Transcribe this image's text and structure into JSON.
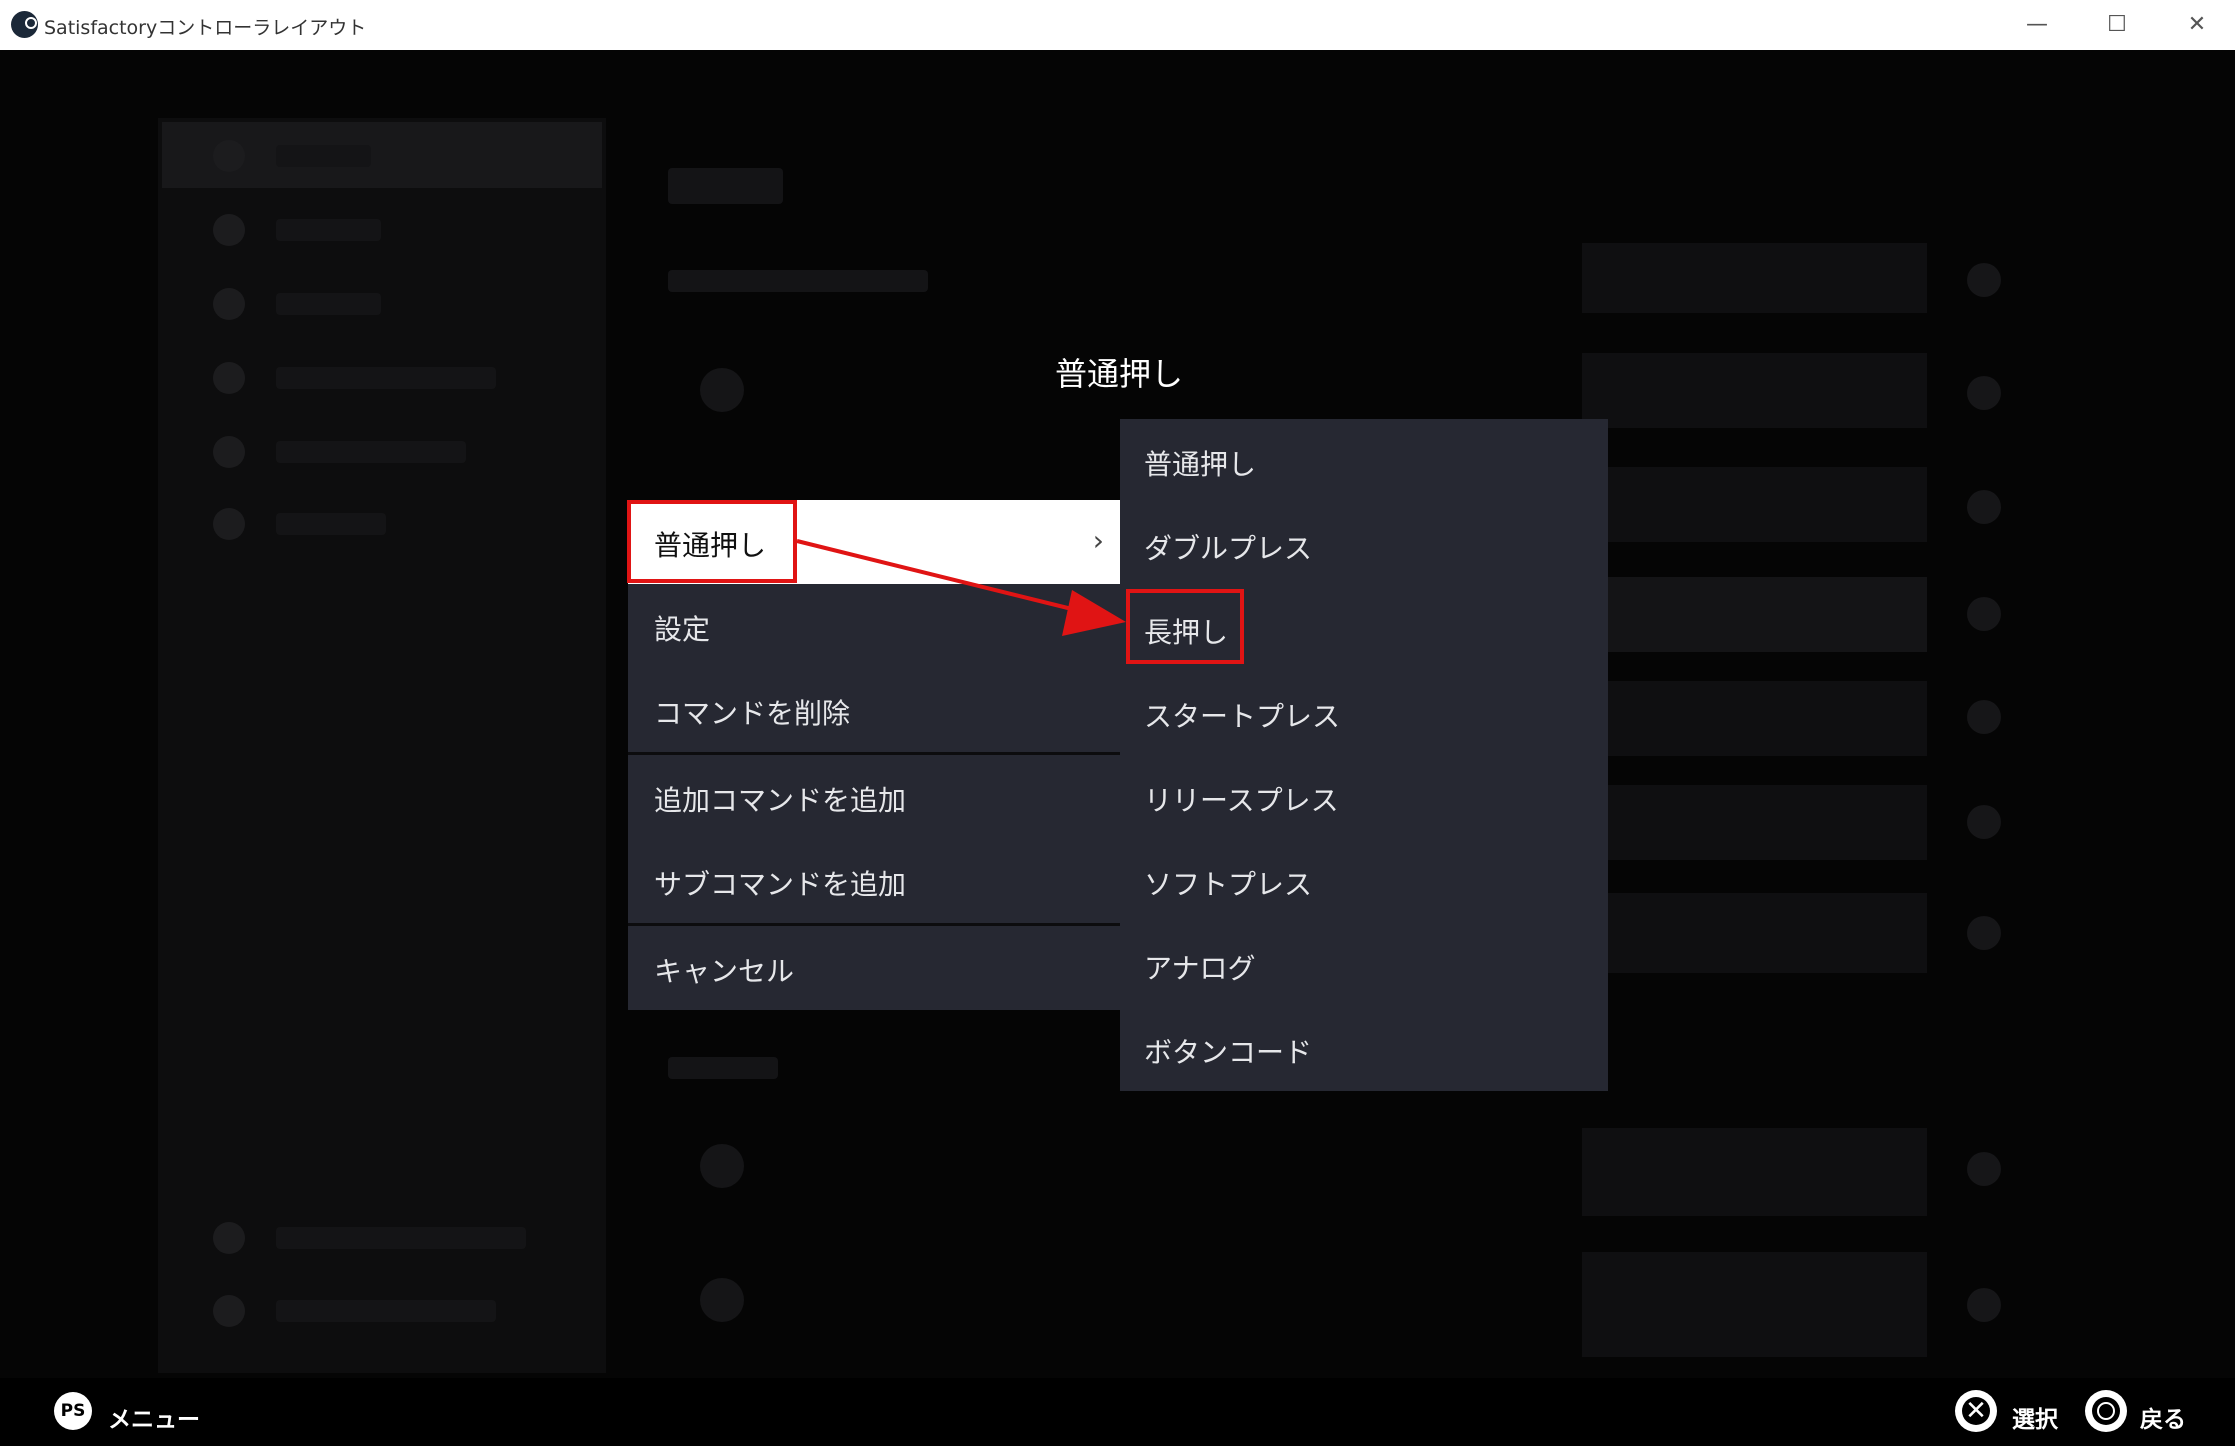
{
  "window": {
    "title": "Satisfactoryコントローラレイアウト",
    "min_glyph": "—",
    "max_glyph": "☐",
    "close_glyph": "✕"
  },
  "dialog": {
    "title": "普通押し"
  },
  "menu": {
    "items": [
      {
        "label": "普通押し",
        "selected": true
      },
      {
        "label": "設定"
      },
      {
        "label": "コマンドを削除"
      },
      {
        "label": "追加コマンドを追加"
      },
      {
        "label": "サブコマンドを追加"
      },
      {
        "label": "キャンセル"
      }
    ],
    "chevron": "›"
  },
  "submenu": {
    "items": [
      {
        "label": "普通押し"
      },
      {
        "label": "ダブルプレス"
      },
      {
        "label": "長押し",
        "highlighted": true
      },
      {
        "label": "スタートプレス"
      },
      {
        "label": "リリースプレス"
      },
      {
        "label": "ソフトプレス"
      },
      {
        "label": "アナログ"
      },
      {
        "label": "ボタンコード"
      }
    ]
  },
  "footer": {
    "ps_glyph": "PS",
    "menu_label": "メニュー",
    "x_glyph": "✕",
    "select_label": "選択",
    "back_label": "戻る"
  },
  "colors": {
    "highlight": "#e01414",
    "menu_bg": "#262832"
  }
}
